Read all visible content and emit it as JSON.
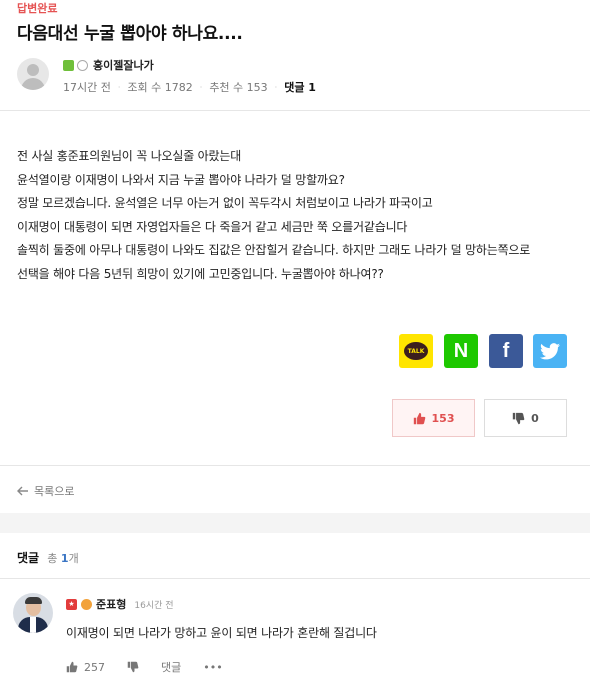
{
  "post": {
    "status": "답변완료",
    "title": "다음대선 누굴 뽑아야 하나요....",
    "author": "홍이젤잘나가",
    "time": "17시간 전",
    "views": "조회 수 1782",
    "recommends": "추천 수 153",
    "comment_label": "댓글 1",
    "body": [
      "전 사실 홍준표의원님이 꼭 나오실줄 아랐는대",
      "윤석열이랑 이재명이 나와서 지금 누굴 뽑아야 나라가 덜 망할까요?",
      "정말 모르겠습니다. 윤석열은 너무 아는거 없이 꼭두각시 처럼보이고 나라가 파국이고",
      "이재명이 대통령이 되면 자영업자들은 다 죽을거 같고 세금만 쭉 오를거같습니다",
      "솔찍히 둘중에 아무나 대통령이 나와도 집값은 안잡힐거 같습니다. 하지만 그래도 나라가 덜 망하는쪽으로",
      "선택을 해야 다음 5년뒤 희망이 있기에 고민중입니다. 누굴뽑아야 하나여??"
    ]
  },
  "share": {
    "kakao_label": "TALK",
    "naver_label": "N",
    "facebook_label": "f"
  },
  "votes": {
    "up": "153",
    "down": "0"
  },
  "nav": {
    "back_label": "목록으로"
  },
  "comments": {
    "header": "댓글",
    "total_prefix": "총",
    "count": "1",
    "total_suffix": "개",
    "items": [
      {
        "author": "준표형",
        "time": "16시간 전",
        "text": "이재명이 되면 나라가 망하고 윤이 되면 나라가 혼란해 질겁니다",
        "likes": "257",
        "reply_label": "댓글",
        "more": "•••"
      }
    ]
  },
  "colors": {
    "status_red": "#e55353",
    "vote_up": "#e05050",
    "link_blue": "#3a75c4",
    "kakao": "#ffe500",
    "naver": "#1ec800",
    "facebook": "#3b5998",
    "twitter": "#4ab3f4"
  },
  "icons": {
    "thumbs_up": "thumbs-up-icon",
    "thumbs_down": "thumbs-down-icon",
    "back": "arrow-left-icon",
    "twitter": "twitter-bird-icon"
  }
}
